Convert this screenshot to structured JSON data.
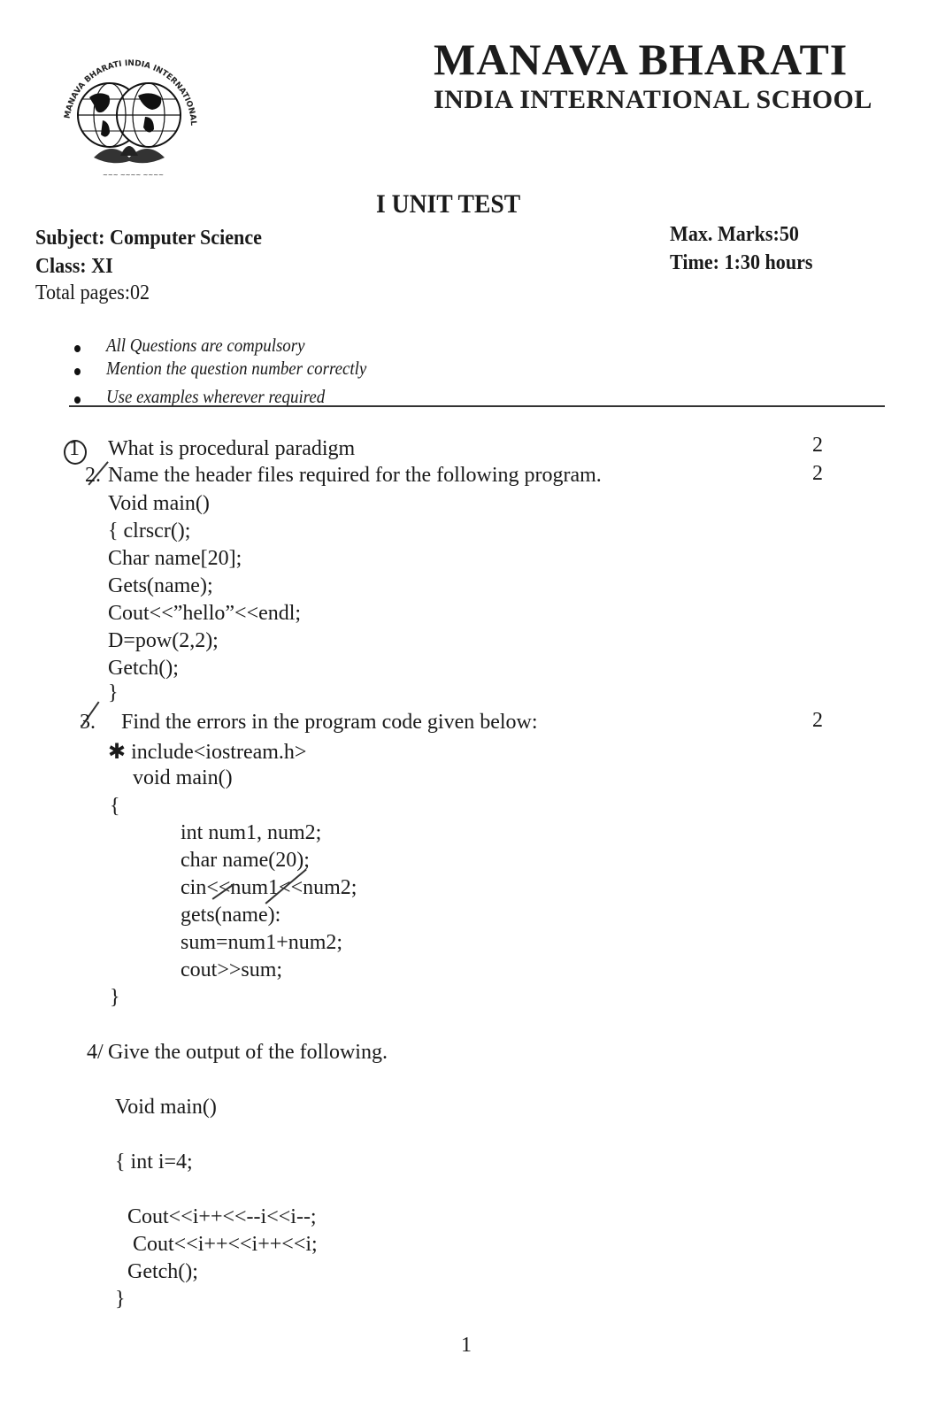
{
  "header": {
    "logo_ring_text": "MANAVA BHARATI INDIA INTERNATIONAL SCHOOL",
    "school_name": "MANAVA BHARATI",
    "school_subtitle": "INDIA INTERNATIONAL SCHOOL",
    "test_title": "I UNIT TEST"
  },
  "meta": {
    "subject": "Subject: Computer Science",
    "class": "Class: XI",
    "total_pages": "Total pages:02",
    "max_marks": "Max. Marks:50",
    "time": "Time: 1:30 hours"
  },
  "instructions": [
    "All Questions are compulsory",
    "Mention the question number correctly",
    "Use examples wherever required"
  ],
  "questions": [
    {
      "number": "1",
      "text": "What is procedural paradigm",
      "marks": "2"
    },
    {
      "number": "2.",
      "text": "Name the header files required for the following program.",
      "marks": "2",
      "code": [
        "Void main()",
        "{ clrscr();",
        "Char name[20];",
        "Gets(name);",
        "Cout<<”hello”<<endl;",
        "D=pow(2,2);",
        "Getch();",
        "}"
      ]
    },
    {
      "number": "3.",
      "text": "Find the errors in the program code given below:",
      "marks": "2",
      "code": [
        "✱ include<iostream.h>",
        "void main()",
        "{",
        "int num1, num2;",
        "char name(20);",
        "cin<<num1<<num2;",
        "gets(name):",
        "sum=num1+num2;",
        "cout>>sum;",
        "}"
      ]
    },
    {
      "number": "4/",
      "text": "Give the output of the following.",
      "code": [
        "Void main()",
        "{ int i=4;",
        "Cout<<i++<<--i<<i--;",
        "Cout<<i++<<i++<<i;",
        "Getch();",
        "}"
      ]
    }
  ],
  "footer": {
    "page_number": "1"
  }
}
